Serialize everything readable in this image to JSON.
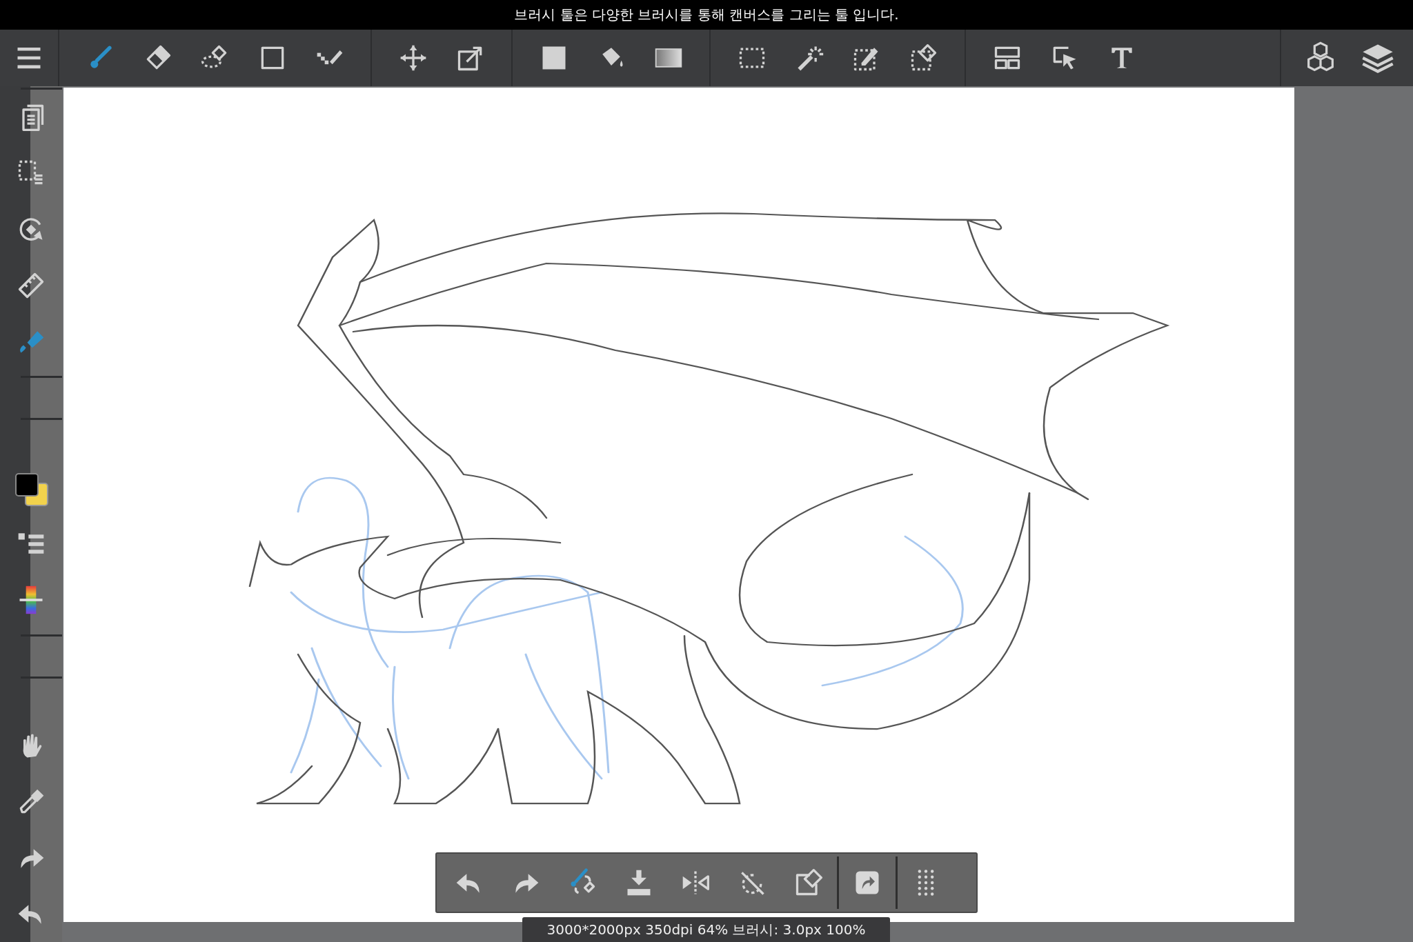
{
  "hint_bar": {
    "text": "브러시 툴은 다양한 브러시를 통해 캔버스를 그리는 툴 입니다."
  },
  "toolbar": {
    "tools": [
      {
        "selected": true
      },
      {
        "selected": false
      },
      {
        "selected": false
      },
      {
        "selected": false
      },
      {
        "selected": false
      },
      {
        "selected": false
      },
      {
        "selected": false
      },
      {
        "selected": false
      },
      {
        "selected": false
      },
      {
        "selected": false
      },
      {
        "selected": false
      },
      {
        "selected": false
      },
      {
        "selected": false
      },
      {
        "selected": false
      },
      {
        "selected": false
      },
      {
        "selected": false
      },
      {
        "selected": false
      }
    ]
  },
  "status_bar": {
    "text": "3000*2000px 350dpi 64% 브러시: 3.0px 100%"
  }
}
